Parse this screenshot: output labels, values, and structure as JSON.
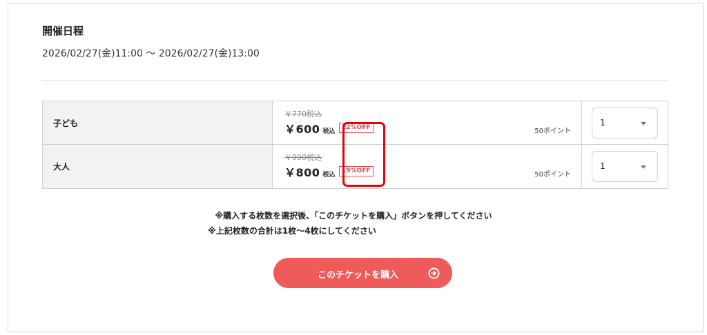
{
  "event": {
    "section_title": "開催日程",
    "schedule": "2026/02/27(金)11:00 〜 2026/02/27(金)13:00"
  },
  "tickets": [
    {
      "name": "子ども",
      "original_price": "￥770税込",
      "price": "￥600",
      "tax_label": "税込",
      "discount": "22%OFF",
      "points": "50ポイント",
      "quantity": "1"
    },
    {
      "name": "大人",
      "original_price": "￥990税込",
      "price": "￥800",
      "tax_label": "税込",
      "discount": "19%OFF",
      "points": "50ポイント",
      "quantity": "1"
    }
  ],
  "notes": {
    "line1": "※購入する枚数を選択後、「このチケットを購入」ボタンを押してください",
    "line2": "※上記枚数の合計は1枚〜4枚にしてください"
  },
  "buy_button": {
    "label": "このチケットを購入",
    "icon": "circle-arrow-right-icon"
  },
  "colors": {
    "accent": "#ef5a5a",
    "discount": "#e5484d",
    "highlight": "#e8000b",
    "name_cell_bg": "#f2f2f2"
  }
}
